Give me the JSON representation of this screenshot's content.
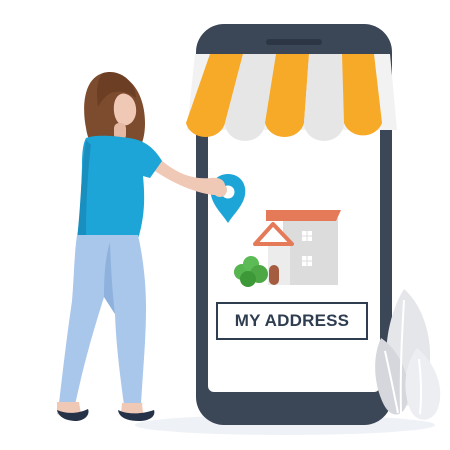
{
  "address_card": {
    "label": "MY ADDRESS"
  },
  "colors": {
    "phone_frame": "#3b4656",
    "awning_orange": "#f7a928",
    "awning_white": "#e7e7e7",
    "shirt": "#1ea5d8",
    "pants": "#a9c7ea",
    "hair": "#7d4b2d",
    "pin": "#1ea5d8",
    "roof": "#e57a59",
    "plant_green": "#56b54f",
    "text_dark": "#2f3d50"
  },
  "icons": [
    "smartphone",
    "shop-awning",
    "woman",
    "location-pin-icon",
    "house-icon",
    "bush",
    "decorative-leaves"
  ]
}
